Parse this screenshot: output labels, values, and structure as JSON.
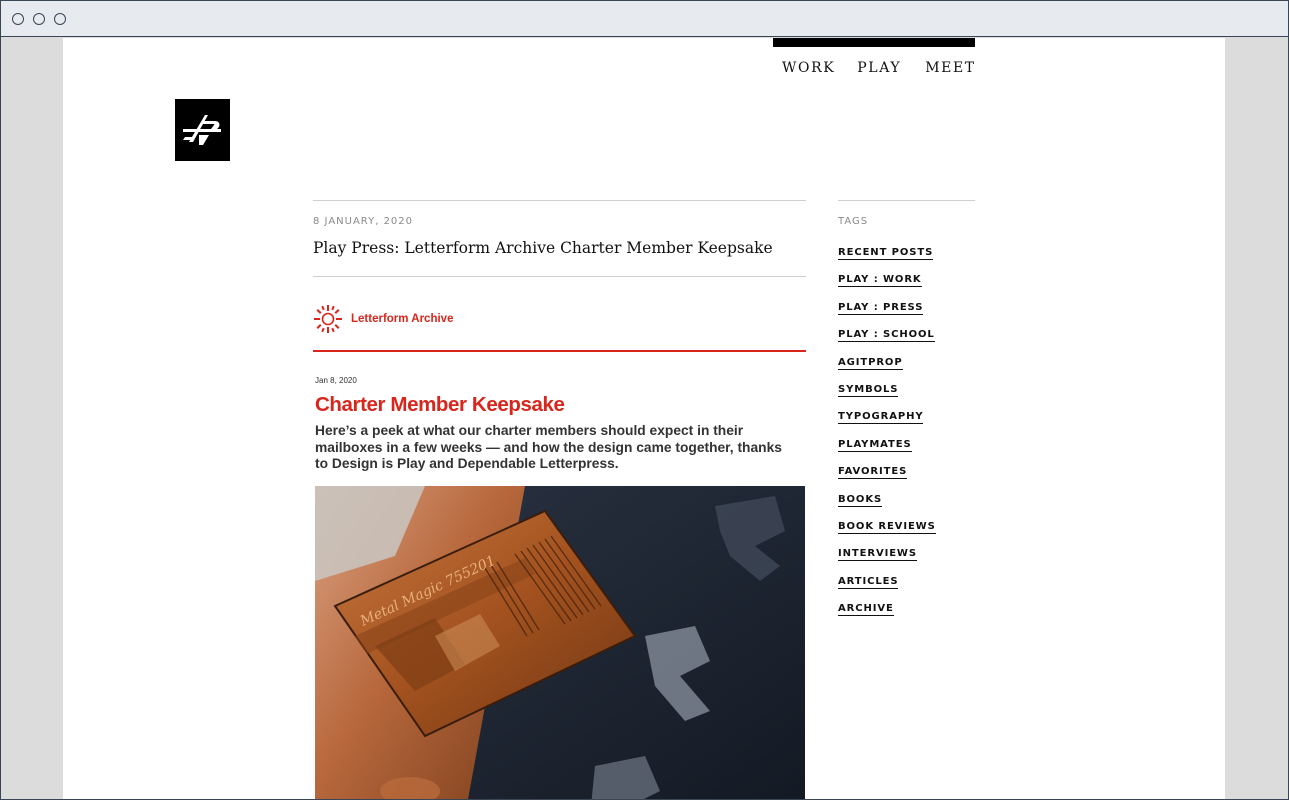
{
  "nav": {
    "items": [
      "WORK",
      "PLAY",
      "MEET"
    ]
  },
  "post": {
    "date": "8 JANUARY, 2020",
    "title": "Play Press: Letterform Archive Charter Member Keepsake"
  },
  "embed": {
    "brand": "Letterform Archive",
    "date": "Jan 8, 2020",
    "title": "Charter Member Keepsake",
    "intro": "Here’s a peek at what our charter members should expect in their mailboxes in a few weeks — and how the design came together, thanks to Design is Play and Dependable Letterpress.",
    "photo_text": "Metal Magic 755201",
    "colors": {
      "accent": "#d9261c"
    }
  },
  "sidebar": {
    "heading": "TAGS",
    "tags": [
      "RECENT POSTS",
      "PLAY : WORK",
      "PLAY : PRESS",
      "PLAY : SCHOOL",
      "AGITPROP",
      "SYMBOLS",
      "TYPOGRAPHY",
      "PLAYMATES",
      "FAVORITES",
      "BOOKS",
      "BOOK REVIEWS",
      "INTERVIEWS",
      "ARTICLES",
      "ARCHIVE"
    ]
  }
}
